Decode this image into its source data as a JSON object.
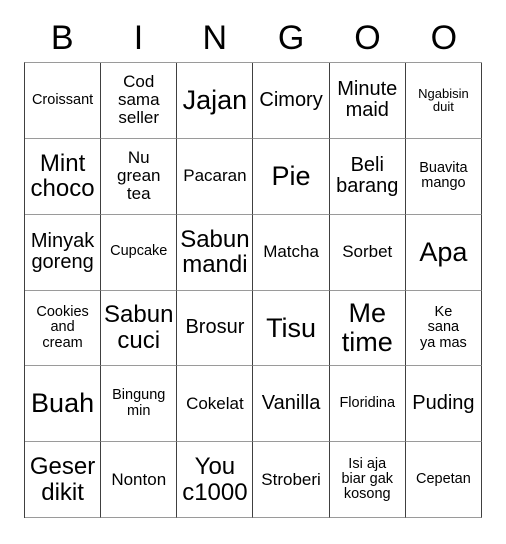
{
  "card": {
    "title": "BINGOO",
    "header_letters": [
      "B",
      "I",
      "N",
      "G",
      "O",
      "O"
    ],
    "columns": 6,
    "rows": 6,
    "colors": {
      "background": "#ffffff",
      "text": "#000000",
      "grid_line_vertical": "#404040",
      "grid_line_horizontal": "#9a9a9a"
    },
    "cells": [
      [
        {
          "text": "Croissant",
          "size": "s"
        },
        {
          "text": "Cod\nsama\nseller",
          "size": "m"
        },
        {
          "text": "Jajan",
          "size": "xxl"
        },
        {
          "text": "Cimory",
          "size": "l"
        },
        {
          "text": "Minute\nmaid",
          "size": "l"
        },
        {
          "text": "Ngabisin\nduit",
          "size": "xs"
        }
      ],
      [
        {
          "text": "Mint\nchoco",
          "size": "xl"
        },
        {
          "text": "Nu\ngrean\ntea",
          "size": "m"
        },
        {
          "text": "Pacaran",
          "size": "m"
        },
        {
          "text": "Pie",
          "size": "xxl"
        },
        {
          "text": "Beli\nbarang",
          "size": "l"
        },
        {
          "text": "Buavita\nmango",
          "size": "s"
        }
      ],
      [
        {
          "text": "Minyak\ngoreng",
          "size": "l"
        },
        {
          "text": "Cupcake",
          "size": "s"
        },
        {
          "text": "Sabun\nmandi",
          "size": "xl"
        },
        {
          "text": "Matcha",
          "size": "m"
        },
        {
          "text": "Sorbet",
          "size": "m"
        },
        {
          "text": "Apa",
          "size": "xxl"
        }
      ],
      [
        {
          "text": "Cookies\nand\ncream",
          "size": "s"
        },
        {
          "text": "Sabun\ncuci",
          "size": "xl"
        },
        {
          "text": "Brosur",
          "size": "l"
        },
        {
          "text": "Tisu",
          "size": "xxl"
        },
        {
          "text": "Me\ntime",
          "size": "xxl"
        },
        {
          "text": "Ke\nsana\nya mas",
          "size": "s"
        }
      ],
      [
        {
          "text": "Buah",
          "size": "xxl"
        },
        {
          "text": "Bingung\nmin",
          "size": "s"
        },
        {
          "text": "Cokelat",
          "size": "m"
        },
        {
          "text": "Vanilla",
          "size": "l"
        },
        {
          "text": "Floridina",
          "size": "s"
        },
        {
          "text": "Puding",
          "size": "l"
        }
      ],
      [
        {
          "text": "Geser\ndikit",
          "size": "xl"
        },
        {
          "text": "Nonton",
          "size": "m"
        },
        {
          "text": "You\nc1000",
          "size": "xl"
        },
        {
          "text": "Stroberi",
          "size": "m"
        },
        {
          "text": "Isi aja\nbiar gak\nkosong",
          "size": "s"
        },
        {
          "text": "Cepetan",
          "size": "s"
        }
      ]
    ]
  }
}
